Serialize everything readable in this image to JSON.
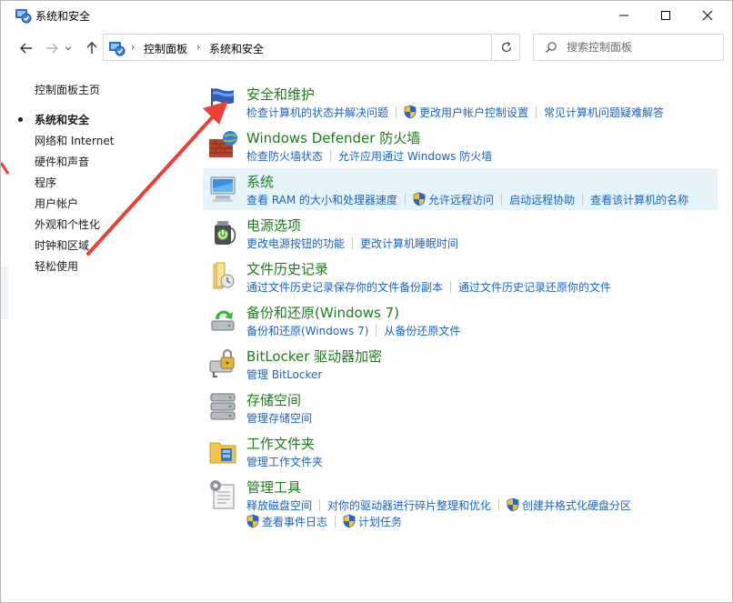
{
  "window": {
    "title": "系统和安全"
  },
  "address": {
    "crumbs": [
      "控制面板",
      "系统和安全"
    ]
  },
  "search": {
    "placeholder": "搜索控制面板"
  },
  "sidebar": {
    "home": "控制面板主页",
    "items": [
      {
        "label": "系统和安全",
        "active": true
      },
      {
        "label": "网络和 Internet"
      },
      {
        "label": "硬件和声音"
      },
      {
        "label": "程序"
      },
      {
        "label": "用户帐户"
      },
      {
        "label": "外观和个性化"
      },
      {
        "label": "时钟和区域"
      },
      {
        "label": "轻松使用"
      }
    ]
  },
  "categories": [
    {
      "title": "安全和维护",
      "icon": "flag-icon",
      "links": [
        {
          "label": "检查计算机的状态并解决问题",
          "shield": false
        },
        {
          "label": "更改用户帐户控制设置",
          "shield": true
        },
        {
          "label": "常见计算机问题疑难解答",
          "shield": false
        }
      ]
    },
    {
      "title": "Windows Defender 防火墙",
      "icon": "firewall-icon",
      "links": [
        {
          "label": "检查防火墙状态",
          "shield": false
        },
        {
          "label": "允许应用通过 Windows 防火墙",
          "shield": false
        }
      ]
    },
    {
      "title": "系统",
      "icon": "computer-icon",
      "highlight": true,
      "links": [
        {
          "label": "查看 RAM 的大小和处理器速度",
          "shield": false
        },
        {
          "label": "允许远程访问",
          "shield": true
        },
        {
          "label": "启动远程协助",
          "shield": false
        },
        {
          "label": "查看该计算机的名称",
          "shield": false
        }
      ]
    },
    {
      "title": "电源选项",
      "icon": "power-icon",
      "links": [
        {
          "label": "更改电源按钮的功能",
          "shield": false
        },
        {
          "label": "更改计算机睡眠时间",
          "shield": false
        }
      ]
    },
    {
      "title": "文件历史记录",
      "icon": "file-history-icon",
      "links": [
        {
          "label": "通过文件历史记录保存你的文件备份副本",
          "shield": false
        },
        {
          "label": "通过文件历史记录还原你的文件",
          "shield": false
        }
      ]
    },
    {
      "title": "备份和还原(Windows 7)",
      "icon": "backup-icon",
      "links": [
        {
          "label": "备份和还原(Windows 7)",
          "shield": false
        },
        {
          "label": "从备份还原文件",
          "shield": false
        }
      ]
    },
    {
      "title": "BitLocker 驱动器加密",
      "icon": "bitlocker-icon",
      "links": [
        {
          "label": "管理 BitLocker",
          "shield": false
        }
      ]
    },
    {
      "title": "存储空间",
      "icon": "storage-icon",
      "links": [
        {
          "label": "管理存储空间",
          "shield": false
        }
      ]
    },
    {
      "title": "工作文件夹",
      "icon": "work-folders-icon",
      "links": [
        {
          "label": "管理工作文件夹",
          "shield": false
        }
      ]
    },
    {
      "title": "管理工具",
      "icon": "admin-tools-icon",
      "links": [
        {
          "label": "释放磁盘空间",
          "shield": false
        },
        {
          "label": "对你的驱动器进行碎片整理和优化",
          "shield": false
        },
        {
          "label": "创建并格式化硬盘分区",
          "shield": true
        }
      ],
      "links2": [
        {
          "label": "查看事件日志",
          "shield": true
        },
        {
          "label": "计划任务",
          "shield": true
        }
      ]
    }
  ],
  "colors": {
    "title_green": "#1e7b1e",
    "link_blue": "#1d63b9",
    "highlight": "#e5f3fb",
    "arrow_red": "#e8413a"
  }
}
